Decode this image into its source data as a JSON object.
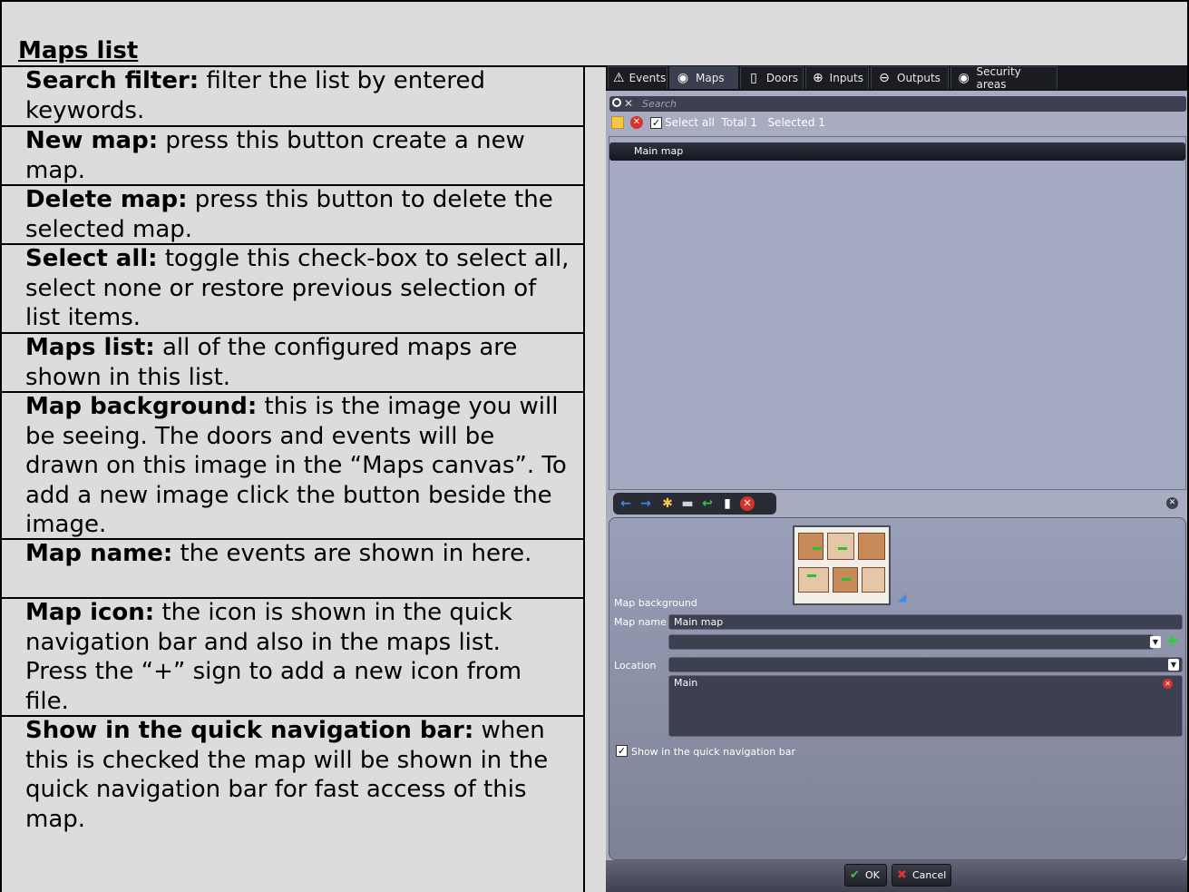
{
  "heading": "Maps list",
  "descriptions": [
    {
      "term": "Search filter:",
      "text": " filter the list by entered keywords."
    },
    {
      "term": "New map:",
      "text": " press this button create a new map."
    },
    {
      "term": "Delete map:",
      "text": " press this button to delete the selected map."
    },
    {
      "term": "Select all:",
      "text": " toggle this check-box to select all, select none or restore previous selection of list items."
    },
    {
      "term": "Maps list:",
      "text": " all of the configured maps are shown in this list."
    },
    {
      "term": "Map background:",
      "text": " this is the image you will be seeing. The doors and events will be drawn on this image in the “Maps canvas”. To add a new image click the button beside the image."
    },
    {
      "term": "Map name:",
      "text": " the events are shown in here."
    },
    {
      "term": "Map icon:",
      "text": " the icon is shown in the quick navigation bar and also in the maps list. Press the “+” sign to add a new icon from file."
    },
    {
      "term": "Show in the quick navigation bar:",
      "text": " when this is checked the map will be shown in the quick navigation bar for fast access of this map."
    }
  ],
  "ui": {
    "tabs": [
      {
        "label": "Events",
        "icon": "warning-icon"
      },
      {
        "label": "Maps",
        "icon": "globe-icon"
      },
      {
        "label": "Doors",
        "icon": "door-icon"
      },
      {
        "label": "Inputs",
        "icon": "input-arrow-icon"
      },
      {
        "label": "Outputs",
        "icon": "output-arrow-icon"
      },
      {
        "label": "Security areas",
        "icon": "globe-icon"
      }
    ],
    "search_placeholder": "Search",
    "select_all_label": "Select all",
    "total_label": "Total 1",
    "selected_label": "Selected 1",
    "map_items": [
      "Main map"
    ],
    "map_background_label": "Map background",
    "map_name_label": "Map name",
    "map_name_value": "Main map",
    "location_label": "Location",
    "location_item": "Main",
    "show_quick_nav_label": "Show in the quick navigation bar",
    "ok_label": "OK",
    "cancel_label": "Cancel"
  }
}
